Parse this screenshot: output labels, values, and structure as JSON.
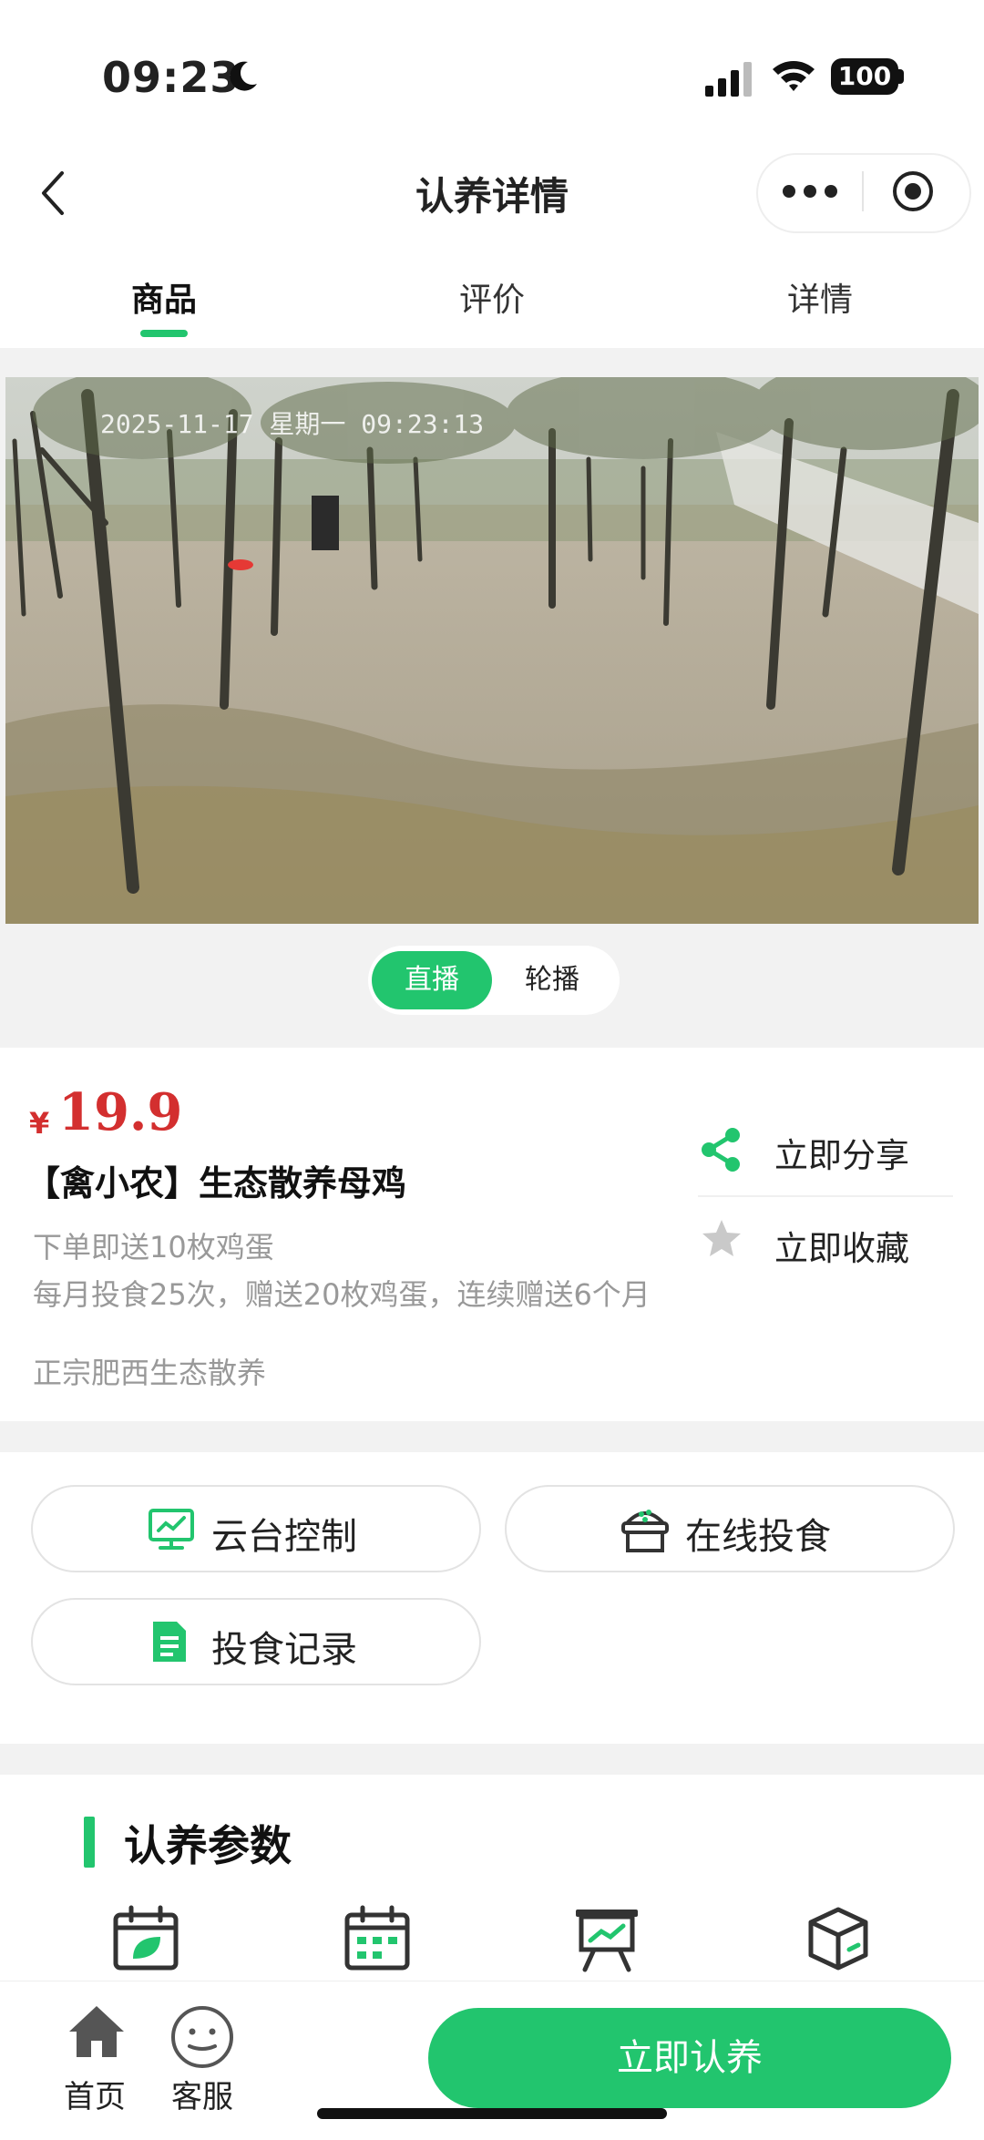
{
  "status_bar": {
    "time": "09:23",
    "battery": "100"
  },
  "header": {
    "title": "认养详情"
  },
  "tabs": [
    {
      "label": "商品",
      "active": true
    },
    {
      "label": "评价",
      "active": false
    },
    {
      "label": "详情",
      "active": false
    }
  ],
  "video": {
    "timestamp": "2025-11-17 星期一 09:23:13",
    "modes": [
      {
        "label": "直播",
        "active": true
      },
      {
        "label": "轮播",
        "active": false
      }
    ]
  },
  "product": {
    "currency": "¥",
    "price": "19.9",
    "name": "【禽小农】生态散养母鸡",
    "desc_lines": [
      "下单即送10枚鸡蛋",
      "每月投食25次，赠送20枚鸡蛋，连续赠送6个月",
      "正宗肥西生态散养"
    ],
    "share_label": "立即分享",
    "favorite_label": "立即收藏"
  },
  "actions": [
    {
      "label": "云台控制",
      "icon": "monitor-icon"
    },
    {
      "label": "在线投食",
      "icon": "feed-bag-icon"
    },
    {
      "label": "投食记录",
      "icon": "document-icon"
    }
  ],
  "params": {
    "title": "认养参数",
    "icons": [
      "calendar-leaf-icon",
      "calendar-icon",
      "chart-board-icon",
      "box-icon"
    ]
  },
  "bottom_bar": {
    "home_label": "首页",
    "service_label": "客服",
    "cta_label": "立即认养"
  },
  "colors": {
    "accent": "#22c56e",
    "price": "#d32f2f"
  }
}
